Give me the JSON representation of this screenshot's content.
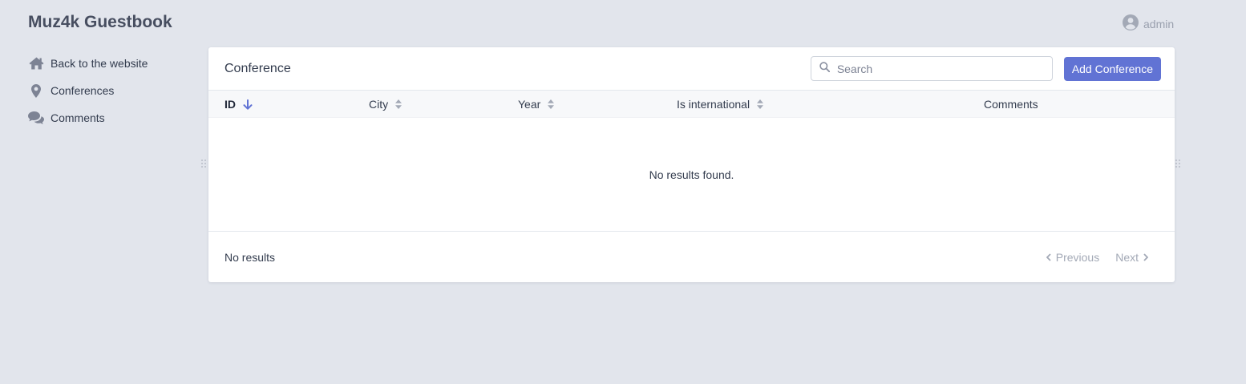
{
  "app": {
    "title": "Muz4k Guestbook"
  },
  "user": {
    "name": "admin",
    "icon": "user-circle-icon"
  },
  "sidebar": {
    "items": [
      {
        "label": "Back to the website",
        "icon": "home-icon"
      },
      {
        "label": "Conferences",
        "icon": "map-marker-icon"
      },
      {
        "label": "Comments",
        "icon": "comments-icon"
      }
    ]
  },
  "content": {
    "title": "Conference",
    "search": {
      "placeholder": "Search",
      "value": ""
    },
    "add_button": "Add Conference",
    "columns": [
      {
        "label": "ID",
        "sort": "desc",
        "active": true
      },
      {
        "label": "City",
        "sort": "sortable"
      },
      {
        "label": "Year",
        "sort": "sortable"
      },
      {
        "label": "Is international",
        "sort": "sortable"
      },
      {
        "label": "Comments",
        "sort": "none"
      }
    ],
    "rows": [],
    "empty_message": "No results found."
  },
  "footer": {
    "results_text": "No results",
    "previous_label": "Previous",
    "next_label": "Next"
  },
  "colors": {
    "accent": "#6173d4",
    "background": "#e2e5ec",
    "card": "#ffffff",
    "muted": "#a3a9b6"
  }
}
